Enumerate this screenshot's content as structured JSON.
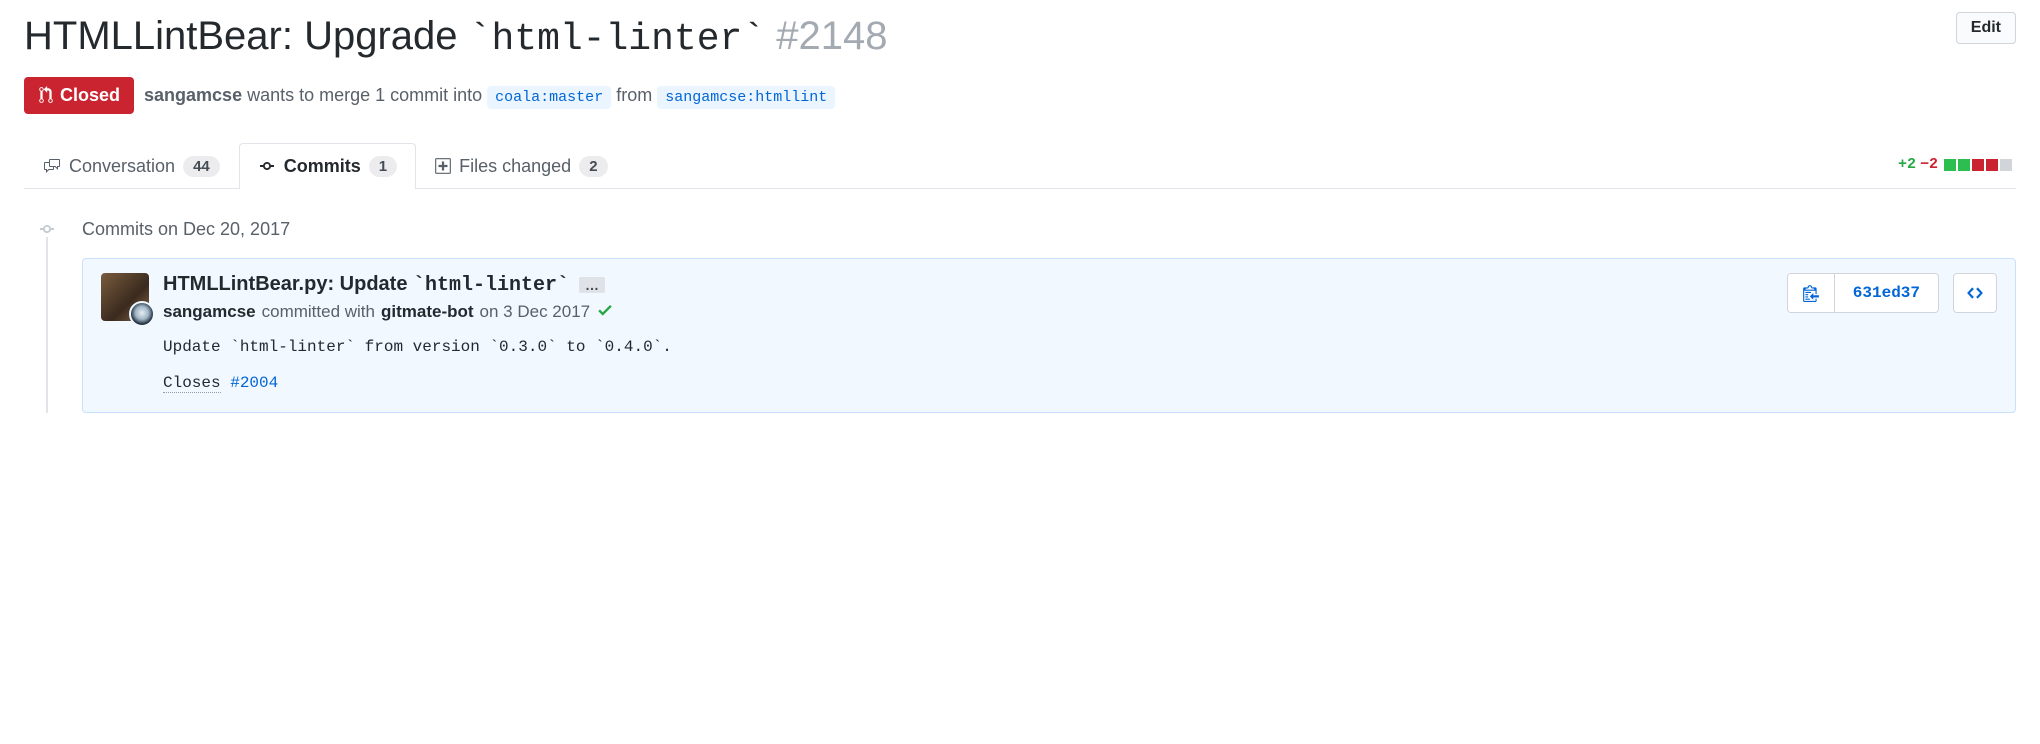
{
  "pr": {
    "title_prefix": "HTMLLintBear: Upgrade ",
    "title_code": "`html-linter`",
    "number": "#2148",
    "state": "Closed",
    "author": "sangamcse",
    "merge_text_1": " wants to merge 1 commit into ",
    "base_branch": "coala:master",
    "merge_text_2": " from ",
    "head_branch": "sangamcse:htmllint",
    "edit_label": "Edit"
  },
  "tabs": {
    "conversation": {
      "label": "Conversation",
      "count": "44"
    },
    "commits": {
      "label": "Commits",
      "count": "1"
    },
    "files": {
      "label": "Files changed",
      "count": "2"
    }
  },
  "diffstat": {
    "additions": "+2",
    "deletions": "−2"
  },
  "commit_group": {
    "title": "Commits on Dec 20, 2017"
  },
  "commit": {
    "title_prefix": "HTMLLintBear.py: Update ",
    "title_code": "`html-linter`",
    "author": "sangamcse",
    "meta_mid": " committed with ",
    "committer": "gitmate-bot",
    "meta_date": " on 3 Dec 2017",
    "desc_line": "Update `html-linter` from version `0.3.0` to `0.4.0`.",
    "closes_label": "Closes",
    "closes_ref": "#2004",
    "sha": "631ed37",
    "ellipsis": "…"
  }
}
